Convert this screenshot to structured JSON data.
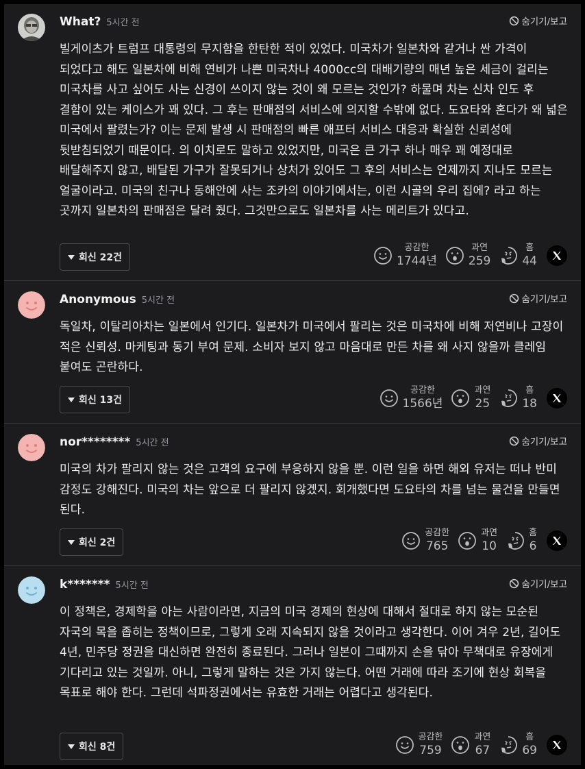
{
  "icons": {
    "hide": "prohibited-circle-icon",
    "reply_toggle": "triangle-down-icon",
    "empathy": "smile-face-icon",
    "surprise": "surprised-face-icon",
    "hmm": "thinking-face-icon",
    "share": "x-logo-icon"
  },
  "colors": {
    "background": "#1c1c1e",
    "divider": "#3a3a3c",
    "avatar_pink": "#f4b4b1",
    "avatar_blue": "#b9def0"
  },
  "comments": [
    {
      "author": "What?",
      "time": "5시간 전",
      "hide_label": "숨기기/보고",
      "avatar": "photo",
      "text": "빌게이츠가 트럼프 대통령의 무지함을 한탄한 적이 있었다. 미국차가 일본차와 같거나 싼 가격이 되었다고 해도 일본차에 비해 연비가 나쁜 미국차나 4000cc의 대배기량의 매년 높은 세금이 걸리는 미국차를 사고 싶어도 사는 신경이 쓰이지 않는 것이 왜 모르는 것인가? 하물며 차는 신차 인도 후 결함이 있는 케이스가 꽤 있다. 그 후는 판매점의 서비스에 의지할 수밖에 없다. 도요타와 혼다가 왜 넓은 미국에서 팔렸는가? 이는 문제 발생 시 판매점의 빠른 애프터 서비스 대응과 확실한 신뢰성에 뒷받침되었기 때문이다. 의 이치로도 말하고 있었지만, 미국은 큰 가구 하나 매우 꽤 예정대로 배달해주지 않고, 배달된 가구가 잘못되거나 상처가 있어도 그 후의 서비스는 언제까지 지나도 모르는 얼굴이라고. 미국의 친구나 동해안에 사는 조카의 이야기에서는, 이런 시골의 우리 집에? 라고 하는 곳까지 일본차의 판매점은 달려 줬다. 그것만으로도 일본차를 사는 메리트가 있다고.",
      "reply_label": "회신 22건",
      "empathy_label": "공감한",
      "empathy_count": "1744년",
      "surprise_label": "과연",
      "surprise_count": "259",
      "hmm_label": "흠",
      "hmm_count": "44"
    },
    {
      "author": "Anonymous",
      "time": "5시간 전",
      "hide_label": "숨기기/보고",
      "avatar": "pink",
      "text": "독일차, 이탈리아차는 일본에서 인기다. 일본차가 미국에서 팔리는 것은 미국차에 비해 저연비나 고장이 적은 신뢰성. 마케팅과 동기 부여 문제. 소비자 보지 않고 마음대로 만든 차를 왜 사지 않을까 클레임 붙여도 곤란하다.",
      "reply_label": "회신 13건",
      "empathy_label": "공감한",
      "empathy_count": "1566년",
      "surprise_label": "과연",
      "surprise_count": "25",
      "hmm_label": "흠",
      "hmm_count": "18"
    },
    {
      "author": "nor********",
      "time": "5시간 전",
      "hide_label": "숨기기/보고",
      "avatar": "pink",
      "text": "미국의 차가 팔리지 않는 것은 고객의 요구에 부응하지 않을 뿐. 이런 일을 하면 해외 유저는 떠나 반미 감정도 강해진다. 미국의 차는 앞으로 더 팔리지 않겠지. 회개했다면 도요타의 차를 넘는 물건을 만들면 된다.",
      "reply_label": "회신 2건",
      "empathy_label": "공감한",
      "empathy_count": "765",
      "surprise_label": "과연",
      "surprise_count": "10",
      "hmm_label": "흠",
      "hmm_count": "6"
    },
    {
      "author": "k*******",
      "time": "5시간 전",
      "hide_label": "숨기기/보고",
      "avatar": "blue",
      "text": "이 정책은, 경제학을 아는 사람이라면, 지금의 미국 경제의 현상에 대해서 절대로 하지 않는 모순된 자국의 목을 좁히는 정책이므로, 그렇게 오래 지속되지 않을 것이라고 생각한다. 이어 겨우 2년, 길어도 4년, 민주당 정권을 대신하면 완전히 종료된다. 그러나 일본이 그때까지 손을 닦아 무책대로 유장에게 기다리고 있는 것일까. 아니, 그렇게 말하는 것은 가지 않는다. 어떤 거래에 따라 조기에 현상 회복을 목표로 해야 한다. 그런데 석파정권에서는 유효한 거래는 어렵다고 생각된다.",
      "reply_label": "회신 8건",
      "empathy_label": "공감한",
      "empathy_count": "759",
      "surprise_label": "과연",
      "surprise_count": "67",
      "hmm_label": "흠",
      "hmm_count": "69"
    }
  ]
}
